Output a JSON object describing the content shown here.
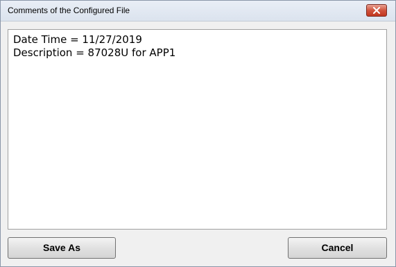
{
  "window": {
    "title": "Comments of the Configured File"
  },
  "comments": {
    "lines": [
      "Date Time = 11/27/2019",
      "Description = 87028U for APP1"
    ]
  },
  "buttons": {
    "save_as_label": "Save As",
    "cancel_label": "Cancel"
  },
  "icons": {
    "close": "close-icon"
  },
  "colors": {
    "close_button": "#c94a32",
    "titlebar": "#dfe6f0"
  }
}
